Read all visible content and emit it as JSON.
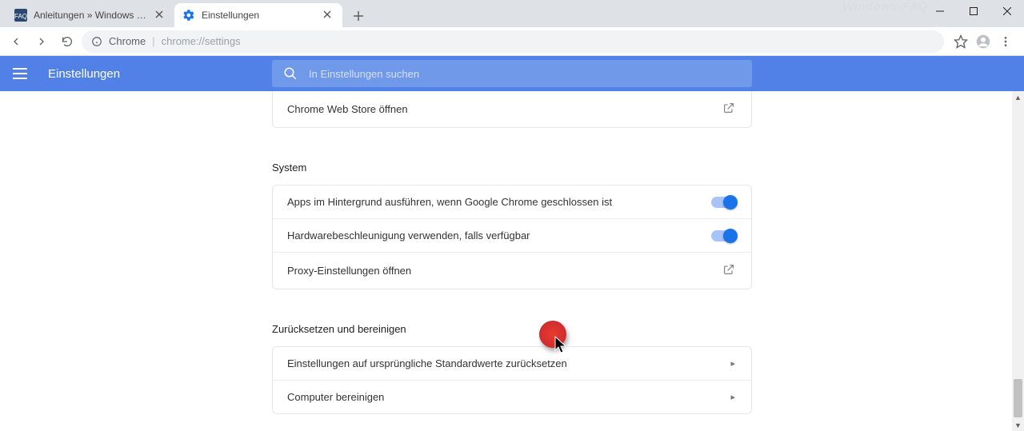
{
  "watermark": "Windows-FAQ",
  "tabs": [
    {
      "title": "Anleitungen » Windows FAQ",
      "active": false
    },
    {
      "title": "Einstellungen",
      "active": true
    }
  ],
  "omnibox": {
    "seg1": "Chrome",
    "seg2": "chrome://settings"
  },
  "header": {
    "title": "Einstellungen",
    "search_placeholder": "In Einstellungen suchen"
  },
  "cards": {
    "webstore": {
      "label": "Chrome Web Store öffnen"
    },
    "system": {
      "title": "System",
      "row_bg": "Apps im Hintergrund ausführen, wenn Google Chrome geschlossen ist",
      "row_hw": "Hardwarebeschleunigung verwenden, falls verfügbar",
      "row_proxy": "Proxy-Einstellungen öffnen"
    },
    "reset": {
      "title": "Zurücksetzen und bereinigen",
      "row_reset": "Einstellungen auf ursprüngliche Standardwerte zurücksetzen",
      "row_clean": "Computer bereinigen"
    }
  }
}
